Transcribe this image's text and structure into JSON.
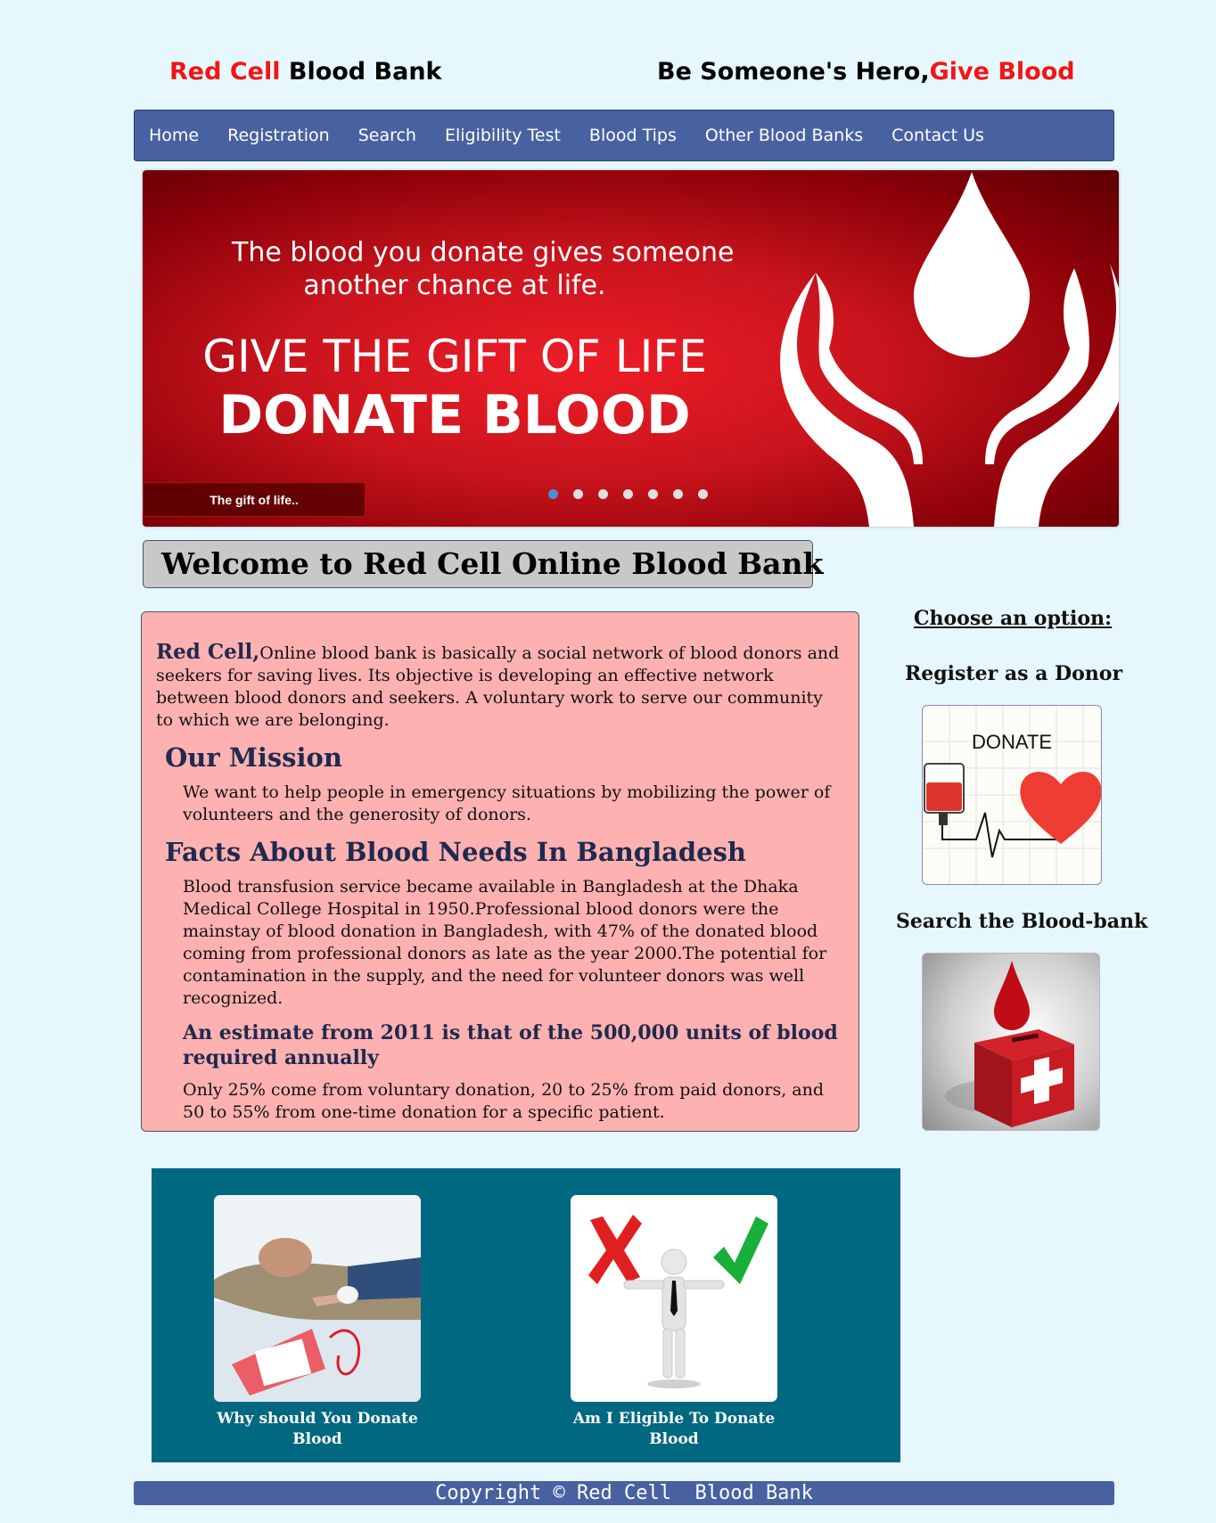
{
  "header": {
    "brand_red": "Red Cell",
    "brand_rest": " Blood Bank",
    "slogan_black": "Be Someone's Hero,",
    "slogan_red": "Give Blood"
  },
  "nav": {
    "items": [
      "Home",
      "Registration",
      "Search",
      "Eligibility Test",
      "Blood Tips",
      "Other Blood Banks",
      "Contact Us"
    ]
  },
  "banner": {
    "line1": "The blood you donate gives someone",
    "line2": "another chance at life.",
    "line3": "GIVE THE GIFT OF LIFE",
    "line4": "DONATE BLOOD",
    "caption": "The gift of life..",
    "slide_count": 7,
    "active_slide": 1
  },
  "welcome": {
    "title": "Welcome to Red Cell Online Blood Bank"
  },
  "info": {
    "intro_strong": "Red Cell,",
    "intro_text": "Online blood bank is basically a social network of blood donors and seekers for saving lives. Its objective is developing an effective network between blood donors and seekers. A voluntary work to serve our community to which we are belonging.",
    "mission_title": "Our Mission",
    "mission_text": "We want to help people in emergency situations by mobilizing the power of volunteers and the generosity of donors.",
    "facts_title": "Facts About Blood Needs In Bangladesh",
    "facts_text": "Blood transfusion service became available in Bangladesh at the Dhaka Medical College Hospital in 1950.Professional blood donors were the mainstay of blood donation in Bangladesh, with 47% of the donated blood coming from professional donors as late as the year 2000.The potential for contamination in the supply, and the need for volunteer donors was well recognized.",
    "estimate_title": "An estimate from 2011 is that of the 500,000 units of blood required annually",
    "estimate_text": "Only 25% come from voluntary donation, 20 to 25% from paid donors, and 50 to 55% from one-time donation for a specific patient."
  },
  "sidebar": {
    "choose_label": "Choose an option:",
    "register_label": "Register as a Donor",
    "donate_image_text": "DONATE",
    "search_label": "Search the Blood-bank"
  },
  "gallery": {
    "item1_caption": "Why should You Donate Blood",
    "item2_caption": "Am I Eligible To Donate Blood"
  },
  "footer": {
    "text": "Copyright © Red Cell  Blood Bank"
  },
  "colors": {
    "page_bg": "#e6f8fe",
    "nav_bg": "#4862a1",
    "brand_red": "#f21515",
    "info_bg": "#feb1b1",
    "teal": "#006880",
    "heading_navy": "#1e2a4e"
  }
}
